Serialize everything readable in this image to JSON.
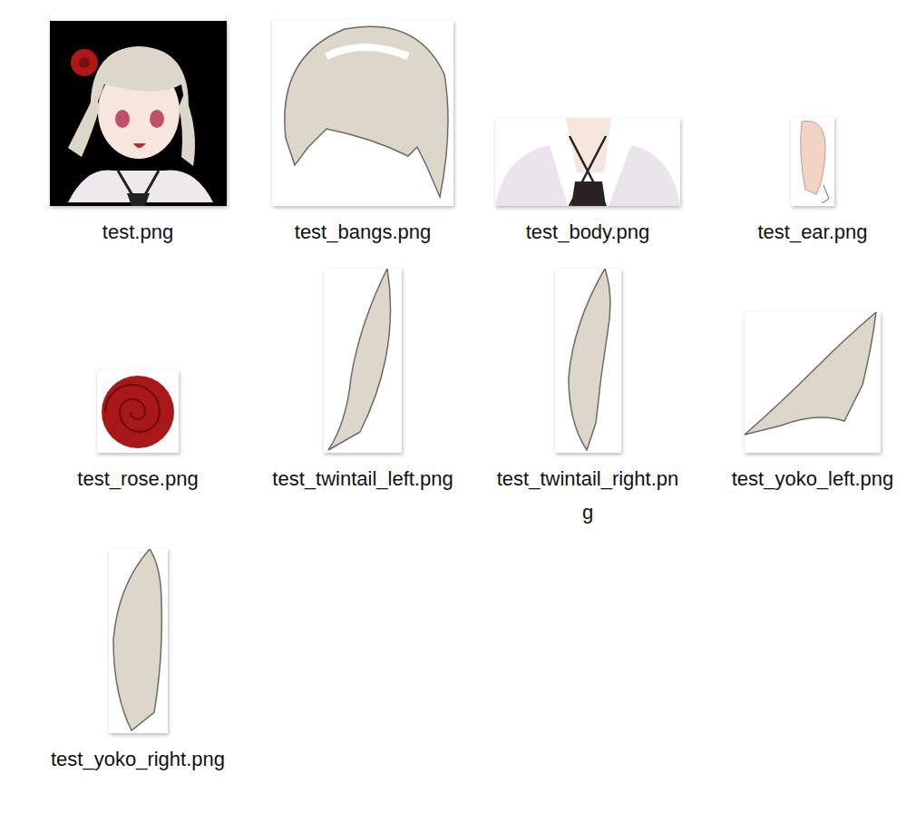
{
  "files": [
    {
      "name": "test.png"
    },
    {
      "name": "test_bangs.png"
    },
    {
      "name": "test_body.png"
    },
    {
      "name": "test_ear.png"
    },
    {
      "name": "test_rose.png"
    },
    {
      "name": "test_twintail_left.png"
    },
    {
      "name": "test_twintail_right.png"
    },
    {
      "name": "test_yoko_left.png"
    },
    {
      "name": "test_yoko_right.png"
    }
  ]
}
